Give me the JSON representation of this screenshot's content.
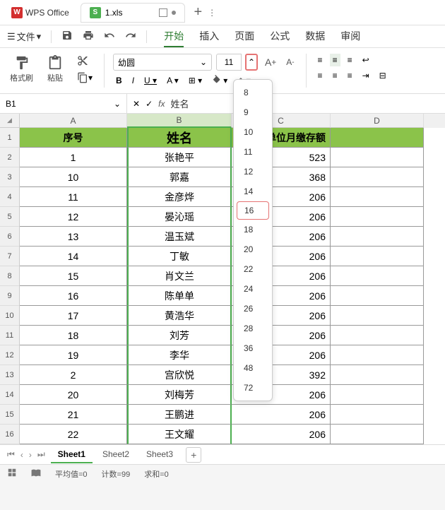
{
  "app": {
    "name": "WPS Office",
    "doc_name": "1.xls",
    "s_letter": "S",
    "w_letter": "W"
  },
  "menu": {
    "file": "文件",
    "tabs": [
      "开始",
      "插入",
      "页面",
      "公式",
      "数据",
      "审阅"
    ],
    "active_tab": 0
  },
  "ribbon": {
    "format_painter": "格式刷",
    "paste": "粘贴",
    "font_name": "幼圆",
    "font_size": "11"
  },
  "cell_ref": {
    "ref": "B1",
    "formula": "姓名",
    "fx": "fx"
  },
  "columns": [
    "A",
    "B",
    "C",
    "D"
  ],
  "header_row": {
    "a": "序号",
    "b": "姓名",
    "c": "单位月缴存额"
  },
  "rows": [
    {
      "n": 1,
      "a": "1",
      "b": "张艳平",
      "c": "523"
    },
    {
      "n": 2,
      "a": "10",
      "b": "郭嘉",
      "c": "368"
    },
    {
      "n": 3,
      "a": "11",
      "b": "金彦烨",
      "c": "206"
    },
    {
      "n": 4,
      "a": "12",
      "b": "晏沁瑶",
      "c": "206"
    },
    {
      "n": 5,
      "a": "13",
      "b": "温玉斌",
      "c": "206"
    },
    {
      "n": 6,
      "a": "14",
      "b": "丁敏",
      "c": "206"
    },
    {
      "n": 7,
      "a": "15",
      "b": "肖文兰",
      "c": "206"
    },
    {
      "n": 8,
      "a": "16",
      "b": "陈单单",
      "c": "206"
    },
    {
      "n": 9,
      "a": "17",
      "b": "黄浩华",
      "c": "206"
    },
    {
      "n": 10,
      "a": "18",
      "b": "刘芳",
      "c": "206"
    },
    {
      "n": 11,
      "a": "19",
      "b": "李华",
      "c": "206"
    },
    {
      "n": 12,
      "a": "2",
      "b": "宫欣悦",
      "c": "392"
    },
    {
      "n": 13,
      "a": "20",
      "b": "刘梅芳",
      "c": "206"
    },
    {
      "n": 14,
      "a": "21",
      "b": "王鹏进",
      "c": "206"
    },
    {
      "n": 15,
      "a": "22",
      "b": "王文耀",
      "c": "206"
    }
  ],
  "size_options": [
    "8",
    "9",
    "10",
    "11",
    "12",
    "14",
    "16",
    "18",
    "20",
    "22",
    "24",
    "26",
    "28",
    "36",
    "48",
    "72"
  ],
  "size_highlight": "16",
  "sheets": {
    "list": [
      "Sheet1",
      "Sheet2",
      "Sheet3"
    ],
    "active": 0
  },
  "status": {
    "avg": "平均值=0",
    "count": "计数=99",
    "sum": "求和=0"
  }
}
